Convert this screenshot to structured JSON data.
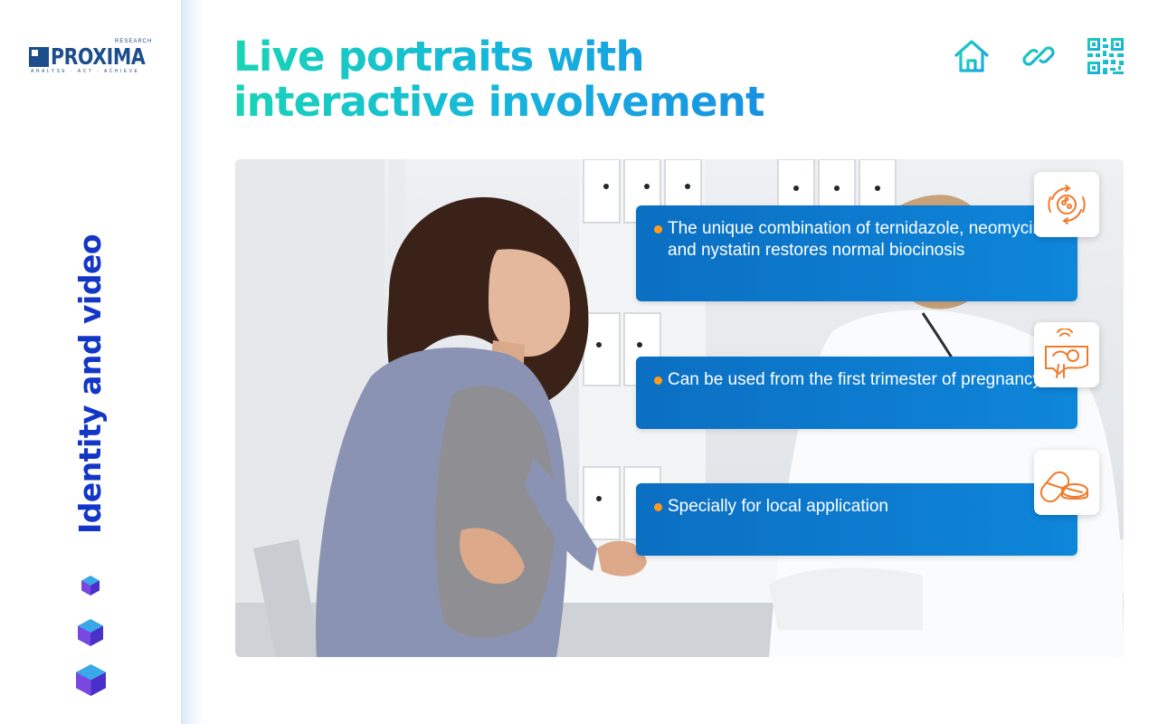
{
  "sidebar": {
    "logo": {
      "word": "PROXIMA",
      "superscript": "RESEARCH",
      "tagline": "ANALYSE · ACT · ACHIEVE"
    },
    "section_title": "Identity and video",
    "nav_icons": [
      "cube-icon",
      "cube-icon",
      "cube-icon"
    ]
  },
  "header": {
    "title": "Live portraits with interactive involvement",
    "icons": [
      "home-icon",
      "link-icon",
      "qr-code-icon"
    ]
  },
  "hero": {
    "image": "pregnant woman at doctor's desk",
    "cards": [
      {
        "text": "The unique combination of ternidazole, neomycin and nystatin restores normal biocinosis",
        "icon": "molecule-cycle-icon"
      },
      {
        "text": "Can be used from the first trimester of pregnancy",
        "icon": "ultrasound-fetus-icon"
      },
      {
        "text": "Specially for local application",
        "icon": "capsule-pill-icon"
      }
    ]
  },
  "colors": {
    "accent_blue": "#1336c7",
    "title_gradient_start": "#19d4b6",
    "title_gradient_end": "#1a7fe6",
    "card_blue": "#0b6fc2",
    "bullet_orange": "#ff9a1e",
    "icon_orange": "#f07a2a"
  }
}
